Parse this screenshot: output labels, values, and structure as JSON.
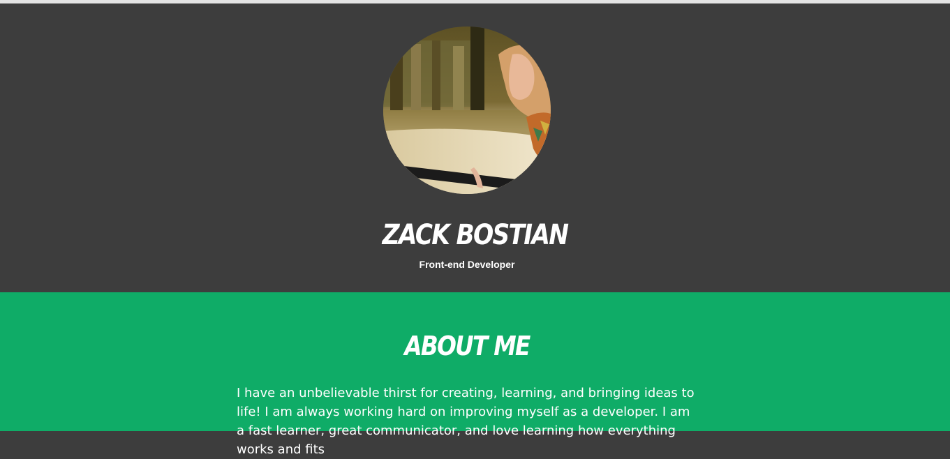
{
  "header": {
    "avatar_alt": "profile-photo",
    "name": "Zack Bostian",
    "role": "Front-end Developer"
  },
  "about": {
    "title": "About Me",
    "body": "I have an unbelievable thirst for creating, learning, and bringing ideas to life! I am always working hard on improving myself as a developer. I am a fast learner, great communicator, and love learning how everything works and fits"
  },
  "colors": {
    "hero_bg": "#3d3d3d",
    "about_bg": "#0fac67",
    "text": "#ffffff"
  }
}
